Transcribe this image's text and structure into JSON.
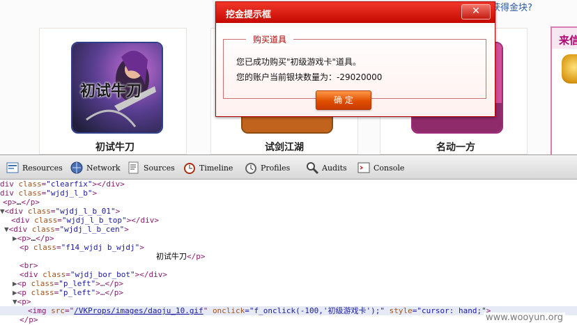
{
  "webpage": {
    "top_right_link": "获得金块?",
    "games": [
      {
        "name": "初试牛刀",
        "logo_text": "初试牛刀"
      },
      {
        "name": "试剑江湖"
      },
      {
        "name": "名动一方"
      }
    ],
    "promo_heading": "来信"
  },
  "dialog": {
    "title": "挖金提示框",
    "close_label": "✕",
    "section_legend": "购买道具",
    "message_line1": "您已成功购买\"初级游戏卡\"道具。",
    "message_line2": "您的账户当前银块数量为：-29020000",
    "ok_button_label": "确 定"
  },
  "devtools": {
    "tabs": [
      {
        "label": "Resources",
        "icon": "resources-icon"
      },
      {
        "label": "Network",
        "icon": "network-icon"
      },
      {
        "label": "Sources",
        "icon": "sources-icon"
      },
      {
        "label": "Timeline",
        "icon": "timeline-icon"
      },
      {
        "label": "Profiles",
        "icon": "profiles-icon"
      },
      {
        "label": "Audits",
        "icon": "audits-icon"
      },
      {
        "label": "Console",
        "icon": "console-icon"
      }
    ],
    "code_lines": [
      {
        "t1": "div ",
        "a1": "class",
        "v1": "\"clearfix\"",
        "t2": "></div>"
      },
      {
        "t1": "div ",
        "a1": "class",
        "v1": "\"wjdj_l_b\"",
        "t2": ">"
      },
      {
        "t1": "<p>",
        "x": "…",
        "t2": "</p>"
      },
      {
        "t1": "<div ",
        "a1": "class",
        "v1": "\"wjdj_l_b_01\"",
        "t2": ">"
      },
      {
        "t1": "<div ",
        "a1": "class",
        "v1": "\"wjdj_l_b_top\"",
        "t2": "></div>"
      },
      {
        "t1": "<div ",
        "a1": "class",
        "v1": "\"wjdj_l_b_cen\"",
        "t2": ">"
      },
      {
        "t1": "<p>",
        "x": "…",
        "t2": "</p>"
      },
      {
        "t1": "<p ",
        "a1": "class",
        "v1": "\"f14_wjdj b_wjdj\"",
        "t2": ">"
      },
      {
        "text": "初试牛刀",
        "t2": "</p>"
      },
      {
        "t1": "<br>"
      },
      {
        "t1": "<div ",
        "a1": "class",
        "v1": "\"wjdj_bor_bot\"",
        "t2": "></div>"
      },
      {
        "t1": "<p ",
        "a1": "class",
        "v1": "\"p_left\"",
        "x": ">…",
        "t2": "</p>"
      },
      {
        "t1": "<p ",
        "a1": "class",
        "v1": "\"p_left\"",
        "x": ">…",
        "t2": "</p>"
      },
      {
        "t1": "<p>"
      },
      {
        "t1": "<img ",
        "a1": "src",
        "eq": "=\"",
        "link": "/VKProps/images/daoju_10.gif",
        "q": "\" ",
        "a2": "onclick",
        "v2": "=\"f_onclick(-100,'初级游戏卡');\" ",
        "a3": "style",
        "v3": "=\"cursor: hand;\"",
        "t2": ">"
      },
      {
        "t1": "</p>"
      }
    ]
  },
  "watermark": "www.wooyun.org",
  "colors": {
    "dialog_title_bg": "#d8160b",
    "ok_button": "#e8560a",
    "tag": "#8a1b6f",
    "attr": "#a0541d",
    "value": "#1a1aa6"
  }
}
